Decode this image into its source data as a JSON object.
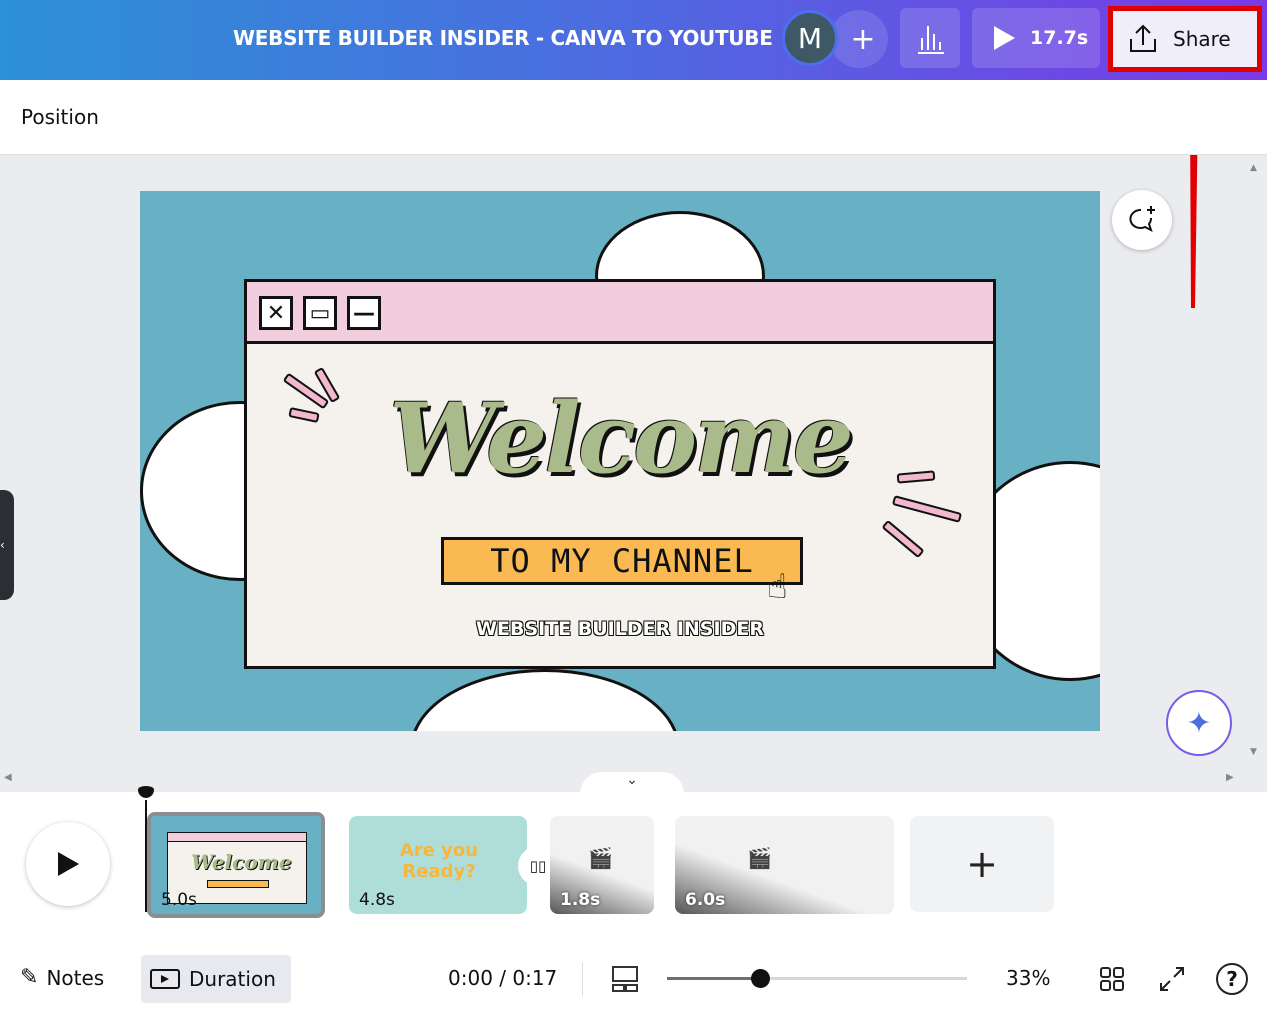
{
  "header": {
    "title": "WEBSITE BUILDER INSIDER - CANVA TO YOUTUBE",
    "avatar_initial": "M",
    "add_label": "+",
    "duration": "17.7s",
    "share_label": "Share"
  },
  "toolbar": {
    "position_label": "Position"
  },
  "slide": {
    "welcome": "Welcome",
    "subtitle": "TO MY CHANNEL",
    "brand": "WEBSITE BUILDER INSIDER",
    "bg_color": "#68b0c3"
  },
  "timeline": {
    "pages": [
      {
        "duration": "5.0s",
        "selected": true
      },
      {
        "duration": "4.8s",
        "text": "Are you Ready?"
      },
      {
        "duration": "1.8s"
      },
      {
        "duration": "6.0s"
      }
    ],
    "add_page": "+"
  },
  "footer": {
    "notes": "Notes",
    "duration": "Duration",
    "time": "0:00 / 0:17",
    "zoom": "33%",
    "zoom_value": 0.31
  }
}
